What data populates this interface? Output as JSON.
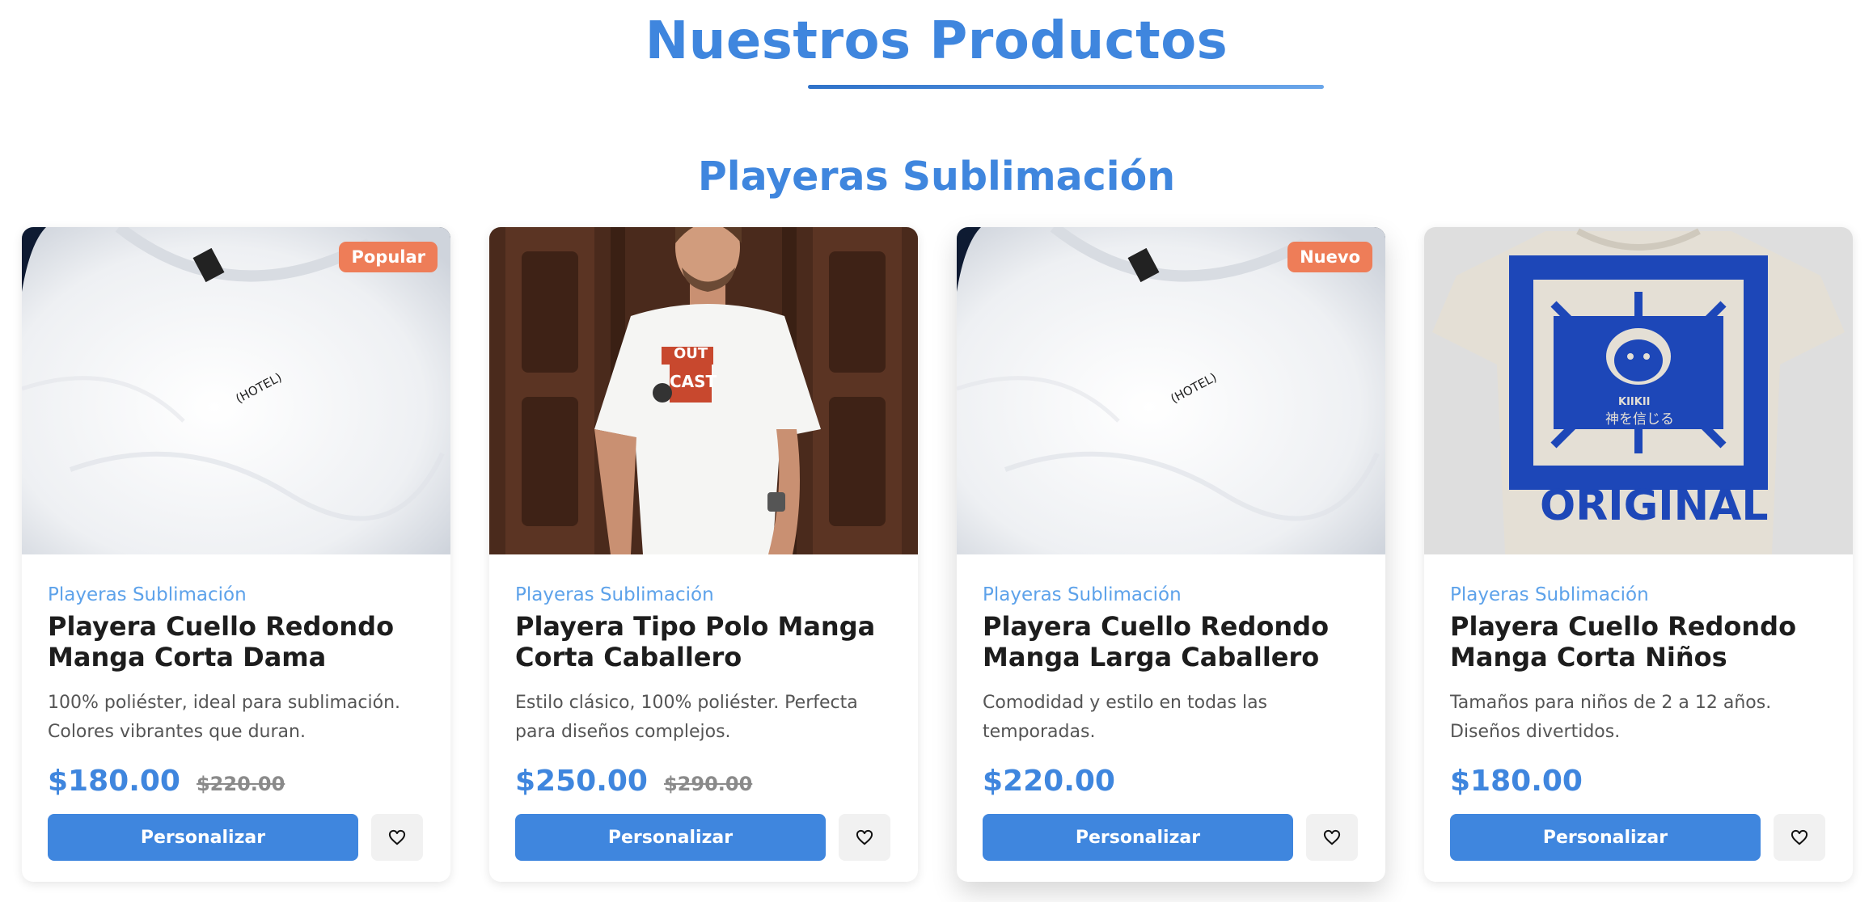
{
  "page": {
    "title": "Nuestros Productos"
  },
  "section": {
    "title": "Playeras Sublimación"
  },
  "products": [
    {
      "badge": "Popular",
      "category": "Playeras Sublimación",
      "name": "Playera Cuello Redondo Manga Corta Dama",
      "description": "100% poliéster, ideal para sublimación. Colores vibrantes que duran.",
      "price": "$180.00",
      "old_price": "$220.00",
      "button": "Personalizar",
      "shirt_print": "(HOTEL)"
    },
    {
      "category": "Playeras Sublimación",
      "name": "Playera Tipo Polo Manga Corta Caballero",
      "description": "Estilo clásico, 100% poliéster. Perfecta para diseños complejos.",
      "price": "$250.00",
      "old_price": "$290.00",
      "button": "Personalizar",
      "shirt_print_top": "OUT",
      "shirt_print_bottom": "CAST"
    },
    {
      "badge": "Nuevo",
      "category": "Playeras Sublimación",
      "name": "Playera Cuello Redondo Manga Larga Caballero",
      "description": "Comodidad y estilo en todas las temporadas.",
      "price": "$220.00",
      "button": "Personalizar",
      "shirt_print": "(HOTEL)"
    },
    {
      "category": "Playeras Sublimación",
      "name": "Playera Cuello Redondo Manga Corta Niños",
      "description": "Tamaños para niños de 2 a 12 años. Diseños divertidos.",
      "price": "$180.00",
      "button": "Personalizar",
      "shirt_print": "ORIGINAL",
      "shirt_print_small": "KIIKII",
      "shirt_print_jp": "神を信じる"
    }
  ],
  "colors": {
    "accent": "#3f86de",
    "badge": "#ee7d58",
    "category": "#5da2ea"
  },
  "icons": {
    "favorite": "heart-icon"
  }
}
